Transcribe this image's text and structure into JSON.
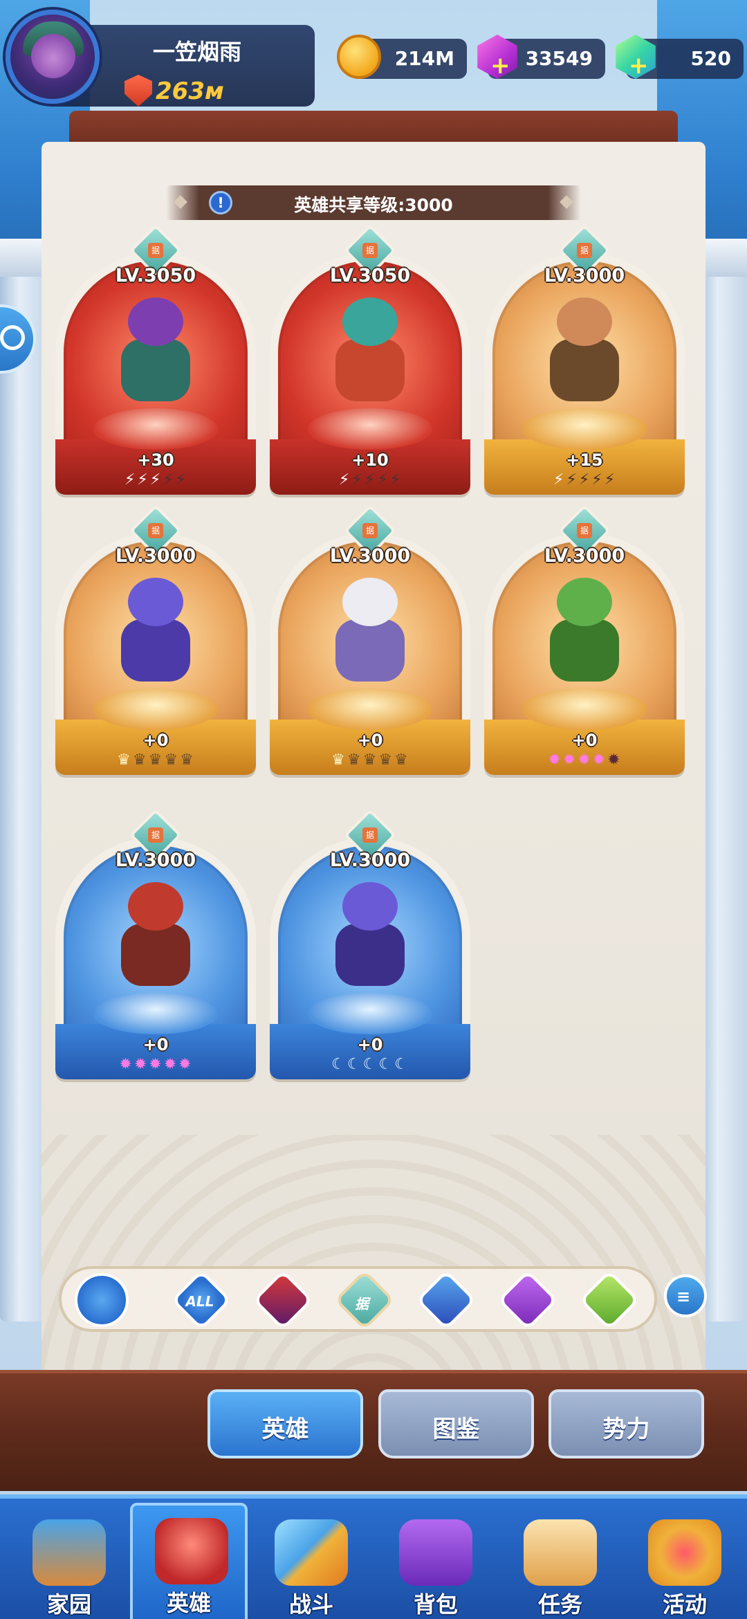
{
  "player": {
    "name": "一笠烟雨",
    "power": "263м"
  },
  "resources": {
    "gold": "214M",
    "purple_gem": "33549",
    "green_gem": "520"
  },
  "shared_level": "英雄共享等级:3000",
  "heroes": [
    {
      "level": "LV.3050",
      "plus": "+30",
      "rarity": "red",
      "pips": "⚡⚡⚡⚡⚡",
      "pip_type": "bolt",
      "active": 3
    },
    {
      "level": "LV.3050",
      "plus": "+10",
      "rarity": "red",
      "pips": "⚡⚡⚡⚡⚡",
      "pip_type": "bolt",
      "active": 1
    },
    {
      "level": "LV.3000",
      "plus": "+15",
      "rarity": "gold",
      "pips": "⚡⚡⚡⚡⚡",
      "pip_type": "bolt",
      "active": 1
    },
    {
      "level": "LV.3000",
      "plus": "+0",
      "rarity": "gold",
      "pips": "♛♛♛♛♛",
      "pip_type": "crown",
      "active": 1
    },
    {
      "level": "LV.3000",
      "plus": "+0",
      "rarity": "gold",
      "pips": "♛♛♛♛♛",
      "pip_type": "crown",
      "active": 1
    },
    {
      "level": "LV.3000",
      "plus": "+0",
      "rarity": "gold",
      "pips": "✹✹✹✹✹",
      "pip_type": "gem",
      "active": 4
    },
    {
      "level": "LV.3000",
      "plus": "+0",
      "rarity": "blue",
      "pips": "✹✹✹✹✹",
      "pip_type": "gem",
      "active": 5
    },
    {
      "level": "LV.3000",
      "plus": "+0",
      "rarity": "blue",
      "pips": "☾☾☾☾☾",
      "pip_type": "moon",
      "active": 5
    }
  ],
  "card_badge": "据",
  "filters": [
    {
      "name": "rank",
      "label": ""
    },
    {
      "name": "all",
      "label": "ALL"
    },
    {
      "name": "demon",
      "label": ""
    },
    {
      "name": "faction-ju",
      "label": "据"
    },
    {
      "name": "orb",
      "label": ""
    },
    {
      "name": "wings",
      "label": ""
    },
    {
      "name": "nature",
      "label": ""
    }
  ],
  "sub_tabs": [
    "英雄",
    "图鉴",
    "势力"
  ],
  "nav": [
    "家园",
    "英雄",
    "战斗",
    "背包",
    "任务",
    "活动"
  ]
}
